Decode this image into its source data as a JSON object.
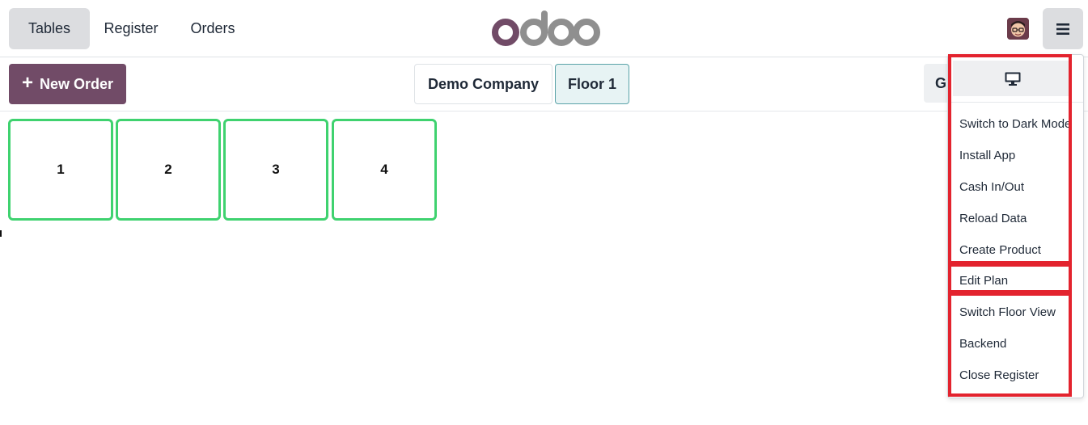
{
  "header": {
    "tabs": [
      {
        "label": "Tables",
        "active": true
      },
      {
        "label": "Register",
        "active": false
      },
      {
        "label": "Orders",
        "active": false
      }
    ],
    "logo_text": "odoo",
    "menu_icon": "hamburger-icon",
    "avatar_icon": "user-avatar"
  },
  "toolbar": {
    "new_order_label": "New Order",
    "company_label": "Demo Company",
    "floor_label": "Floor 1",
    "partial_button_label": "G"
  },
  "tables": [
    {
      "number": "1"
    },
    {
      "number": "2"
    },
    {
      "number": "3"
    },
    {
      "number": "4"
    }
  ],
  "dropdown": {
    "display_icon": "monitor-icon",
    "items": [
      "Switch to Dark Mode",
      "Install App",
      "Cash In/Out",
      "Reload Data",
      "Create Product",
      "Edit Plan",
      "Switch Floor View",
      "Backend",
      "Close Register"
    ]
  },
  "colors": {
    "brand": "#714b67",
    "table_border": "#3fd26f",
    "highlight": "#e3232e",
    "active_tab_bg": "#dcdde0",
    "floor_active_bg": "#e7f3f4",
    "floor_active_border": "#5aa3a8"
  }
}
